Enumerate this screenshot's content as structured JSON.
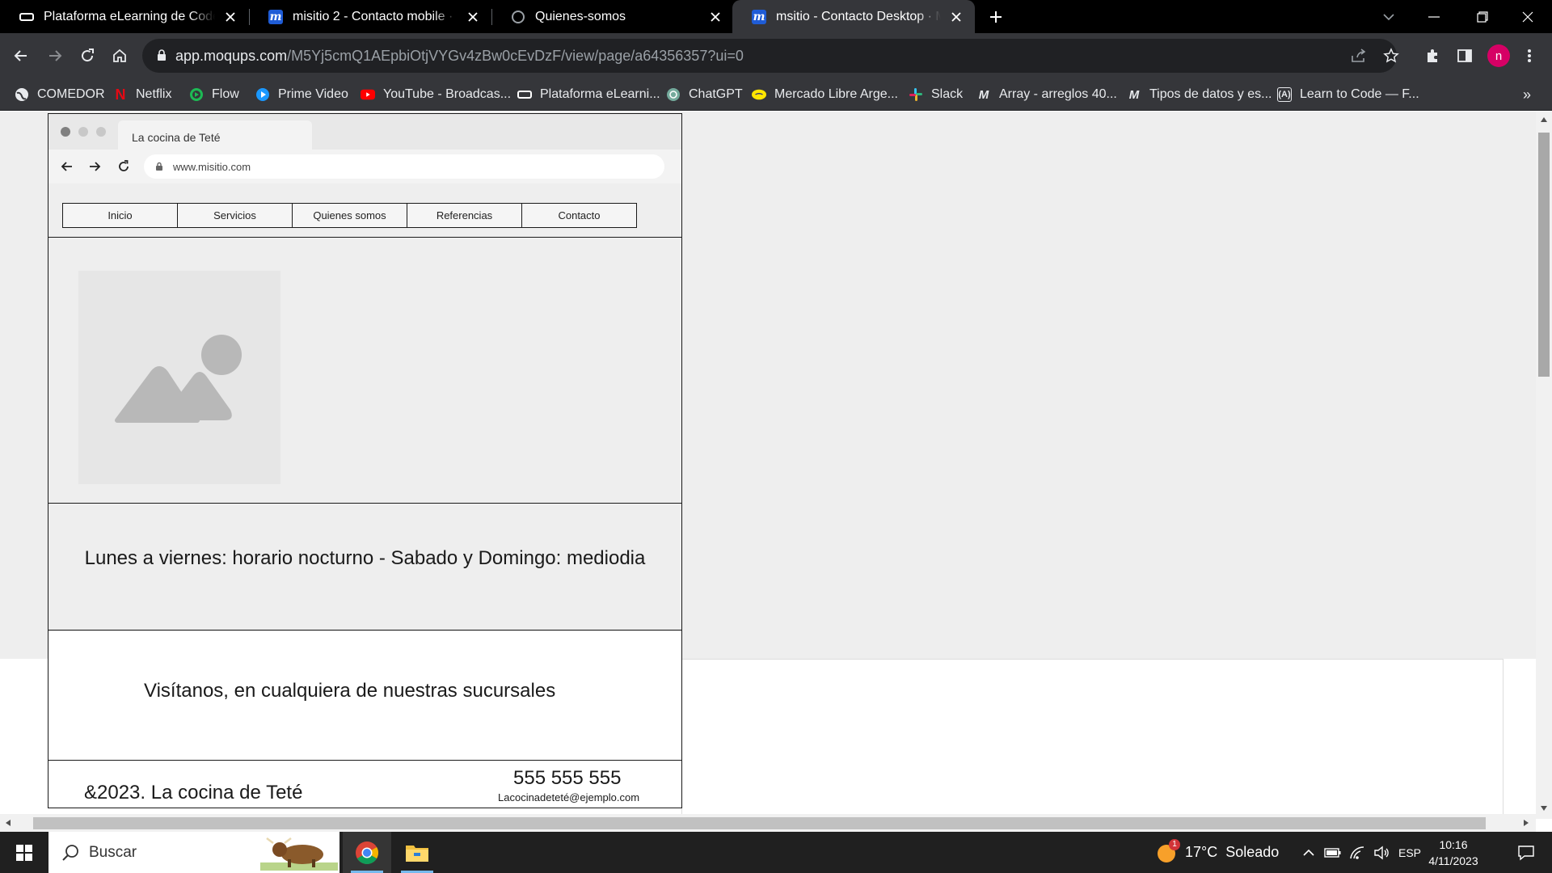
{
  "tabs": [
    {
      "title": "Plataforma eLearning de Coderhouse",
      "favicon": "coderhouse-icon",
      "active": false
    },
    {
      "title": "misitio 2 - Contacto mobile · Moqups",
      "favicon": "moqups-icon",
      "active": false
    },
    {
      "title": "Quienes-somos",
      "favicon": "globe-icon",
      "active": false
    },
    {
      "title": "msitio - Contacto Desktop · Moqups",
      "favicon": "moqups-icon",
      "active": true
    }
  ],
  "address": {
    "host": "app.moqups.com",
    "path": "/M5Yj5cmQ1AEpbiOtjVYGv4zBw0cEvDzF/view/page/a64356357?ui=0"
  },
  "profile": {
    "initial": "n",
    "color": "#d60065"
  },
  "bookmarks": [
    {
      "label": "COMEDOR",
      "icon": "globe-icon"
    },
    {
      "label": "Netflix",
      "icon": "netflix-icon"
    },
    {
      "label": "Flow",
      "icon": "flow-icon"
    },
    {
      "label": "Prime Video",
      "icon": "prime-video-icon"
    },
    {
      "label": "YouTube - Broadcas...",
      "icon": "youtube-icon"
    },
    {
      "label": "Plataforma eLearni...",
      "icon": "coderhouse-icon"
    },
    {
      "label": "ChatGPT",
      "icon": "chatgpt-icon"
    },
    {
      "label": "Mercado Libre Arge...",
      "icon": "mercadolibre-icon"
    },
    {
      "label": "Slack",
      "icon": "slack-icon"
    },
    {
      "label": "Array - arreglos 40...",
      "icon": "mdn-icon"
    },
    {
      "label": "Tipos de datos y es...",
      "icon": "mdn-icon"
    },
    {
      "label": "Learn to Code — F...",
      "icon": "freecodecamp-icon"
    }
  ],
  "mock": {
    "tab_title": "La cocina de Teté",
    "url": "www.misitio.com",
    "nav": [
      "Inicio",
      "Servicios",
      "Quienes somos",
      "Referencias",
      "Contacto"
    ],
    "hours_text": "Lunes a viernes: horario nocturno - Sabado y Domingo: mediodia",
    "visit_text": "Visítanos, en cualquiera de nuestras sucursales",
    "footer_copy": "&2023. La cocina de Teté",
    "footer_phone": "555 555 555",
    "footer_email": "Lacocinadeteté@ejemplo.com"
  },
  "taskbar": {
    "search_placeholder": "Buscar",
    "weather_temp": "17°C",
    "weather_desc": "Soleado",
    "weather_badge": "1",
    "language": "ESP",
    "time": "10:16",
    "date": "4/11/2023"
  },
  "colors": {
    "tabstrip_bg": "#000000",
    "toolbar_bg": "#35363a",
    "omnibox_bg": "#202124",
    "canvas_bg": "#eeeeee",
    "taskbar_bg": "#202020",
    "moqups_blue": "#1f5cd6"
  }
}
